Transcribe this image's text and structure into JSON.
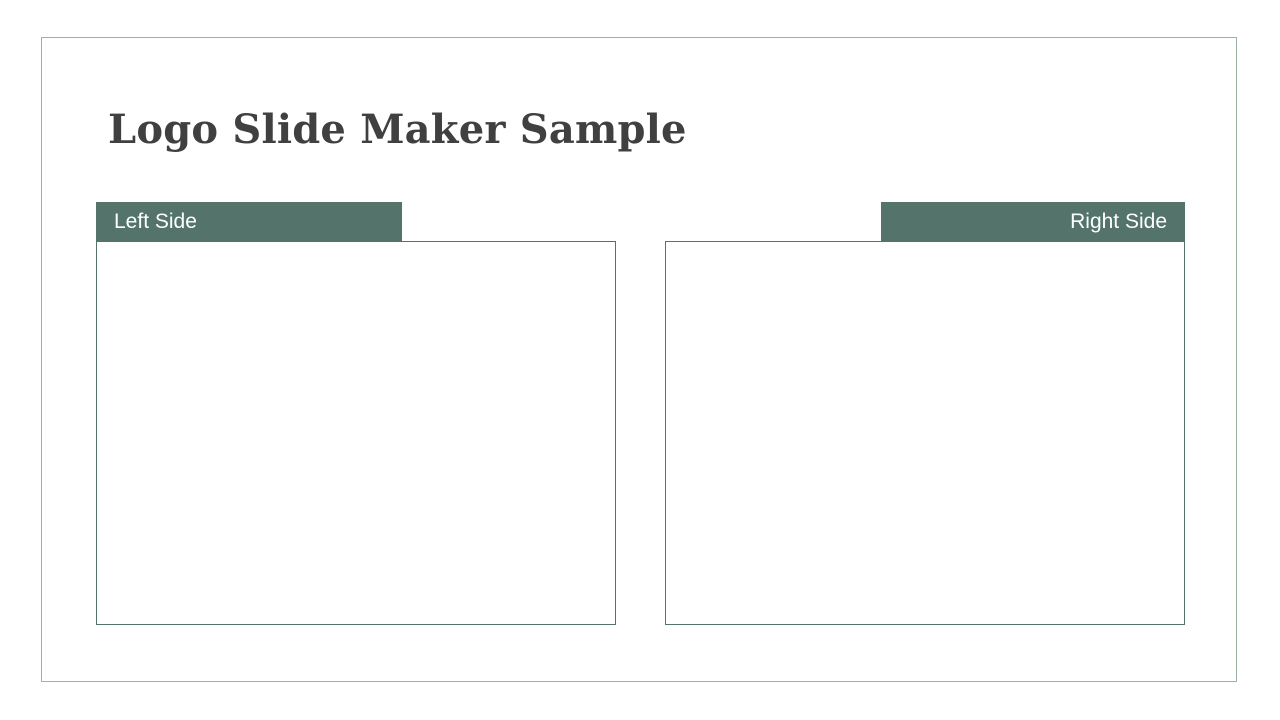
{
  "slide": {
    "title": "Logo Slide Maker Sample",
    "left_panel": {
      "label": "Left Side"
    },
    "right_panel": {
      "label": "Right Side"
    }
  },
  "colors": {
    "accent": "#53736b",
    "frame_border": "#9cb3a1",
    "title_text": "#404040",
    "background": "#ffffff"
  }
}
